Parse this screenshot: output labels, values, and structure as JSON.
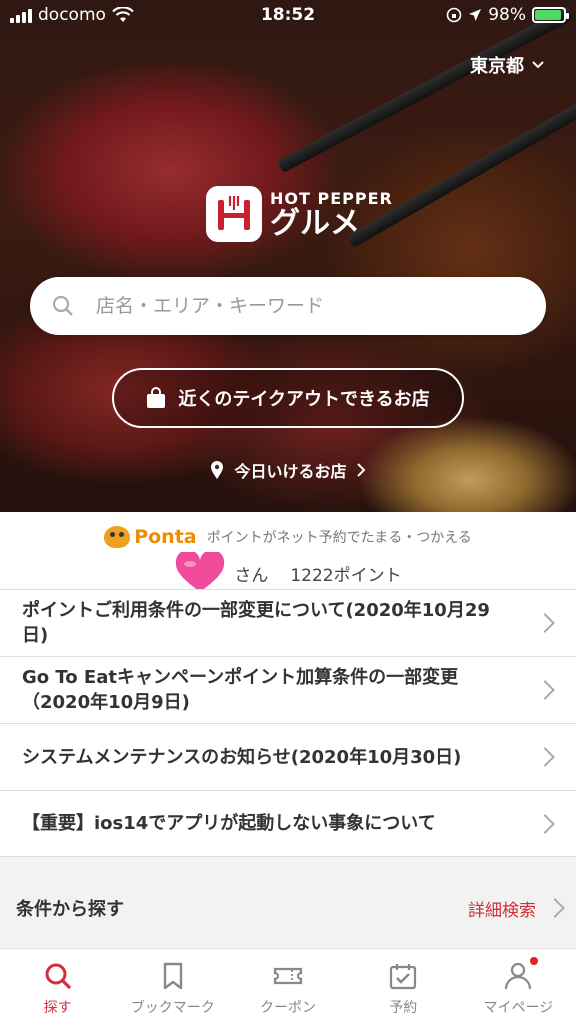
{
  "status": {
    "carrier": "docomo",
    "time": "18:52",
    "battery": "98%",
    "battery_level": 0.98
  },
  "region": "東京都",
  "brand": {
    "top": "HOT PEPPER",
    "name": "グルメ"
  },
  "search": {
    "placeholder": "店名・エリア・キーワード"
  },
  "takeout_label": "近くのテイクアウトできるお店",
  "today_label": "今日いけるお店",
  "ponta": {
    "logo": "Ponta",
    "description": "ポイントがネット予約でたまる・つかえる",
    "honorific": "さん",
    "points": "1222ポイント"
  },
  "news": [
    {
      "text": "ポイントご利用条件の一部変更について(2020年10月29日)"
    },
    {
      "text": "Go To Eatキャンペーンポイント加算条件の一部変更（2020年10月9日)"
    },
    {
      "text": "システムメンテナンスのお知らせ(2020年10月30日)"
    },
    {
      "text": "【重要】ios14でアプリが起動しない事象について"
    }
  ],
  "conditions": {
    "label": "条件から探す",
    "detail_search": "詳細検索"
  },
  "tabs": [
    {
      "label": "探す",
      "icon": "search-icon"
    },
    {
      "label": "ブックマーク",
      "icon": "bookmark-icon"
    },
    {
      "label": "クーポン",
      "icon": "ticket-icon"
    },
    {
      "label": "予約",
      "icon": "calendar-icon"
    },
    {
      "label": "マイページ",
      "icon": "person-icon"
    }
  ],
  "colors": {
    "accent": "#d0303a",
    "ponta": "#f08c00",
    "battery": "#4cd964"
  }
}
